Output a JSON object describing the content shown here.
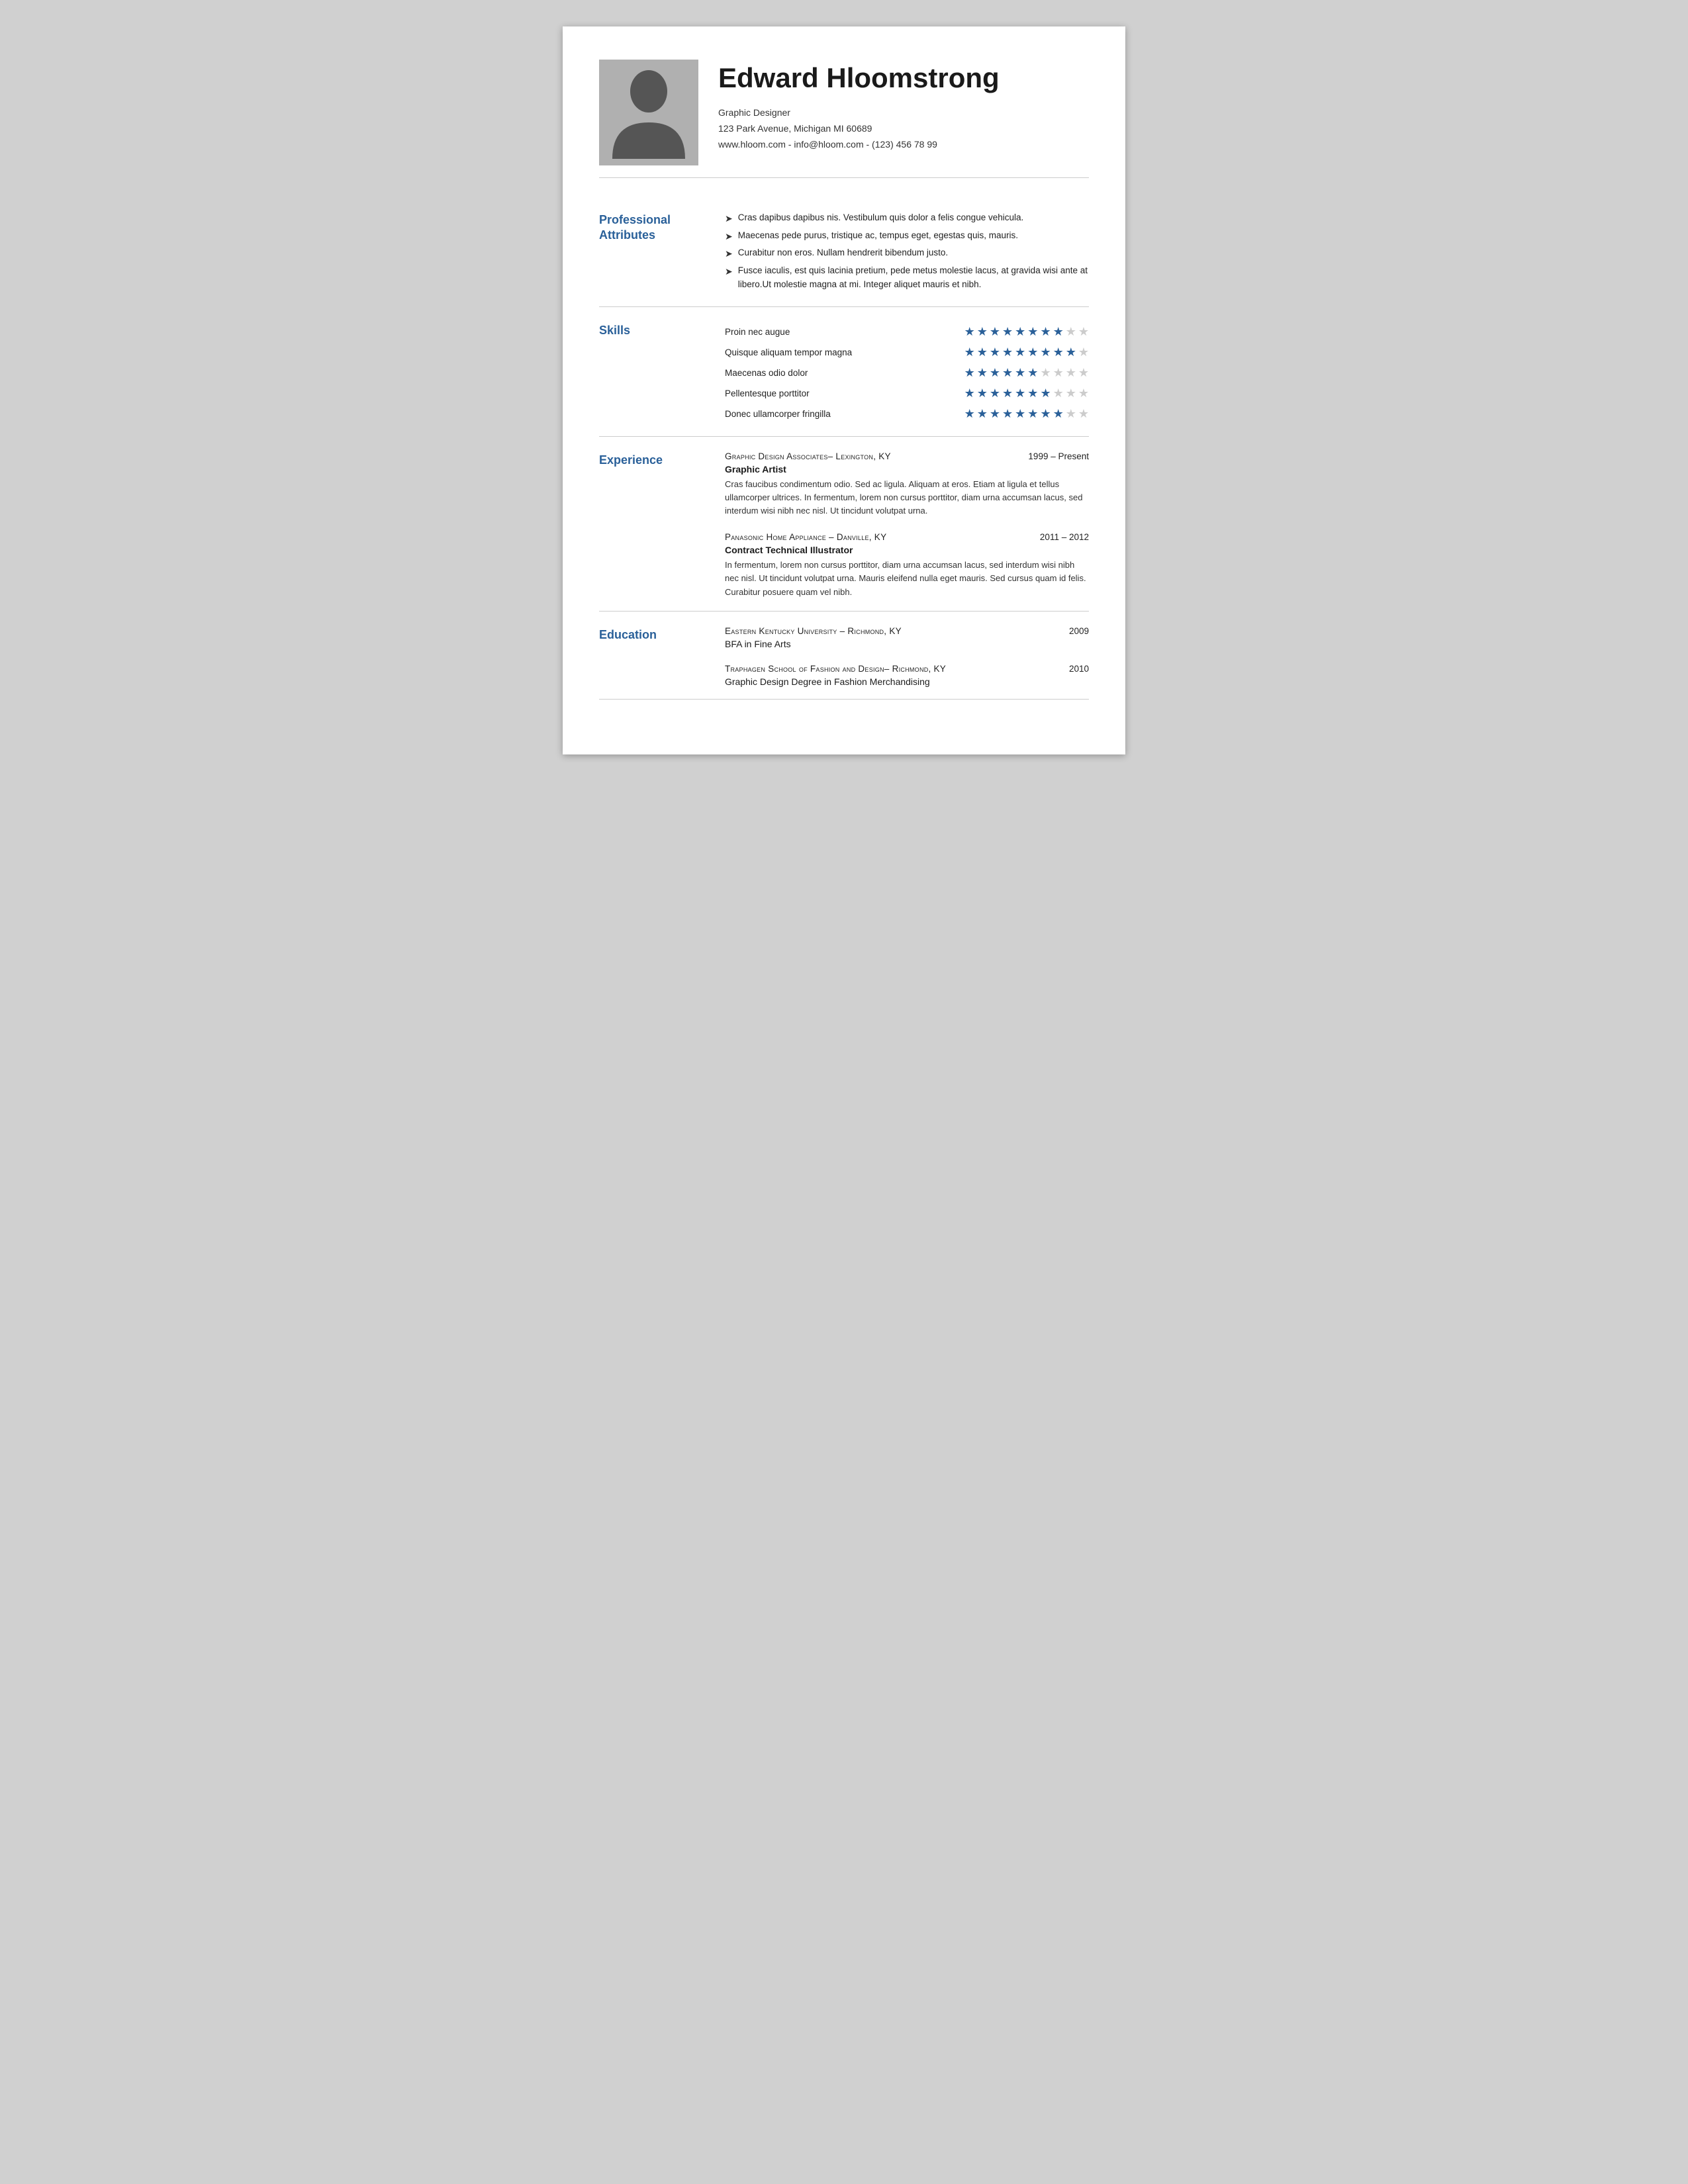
{
  "header": {
    "name": "Edward Hloomstrong",
    "title": "Graphic Designer",
    "address": "123 Park Avenue, Michigan MI 60689",
    "contact": "www.hloom.com - info@hloom.com - (123) 456 78 99"
  },
  "sections": {
    "professional": {
      "label": "Professional\nAttributes",
      "items": [
        "Cras dapibus dapibus nis. Vestibulum quis dolor a felis congue vehicula.",
        "Maecenas pede purus, tristique ac, tempus eget, egestas quis, mauris.",
        "Curabitur non eros. Nullam hendrerit bibendum justo.",
        "Fusce iaculis, est quis lacinia pretium, pede metus molestie lacus, at gravida wisi ante at libero.Ut molestie magna at mi. Integer aliquet mauris et nibh."
      ]
    },
    "skills": {
      "label": "Skills",
      "items": [
        {
          "name": "Proin nec augue",
          "filled": 8,
          "total": 10
        },
        {
          "name": "Quisque aliquam tempor magna",
          "filled": 9,
          "total": 10
        },
        {
          "name": "Maecenas odio dolor",
          "filled": 6,
          "total": 10
        },
        {
          "name": "Pellentesque porttitor",
          "filled": 7,
          "total": 10
        },
        {
          "name": "Donec ullamcorper fringilla",
          "filled": 8,
          "total": 10
        }
      ]
    },
    "experience": {
      "label": "Experience",
      "items": [
        {
          "company": "Graphic Design Associates– Lexington, KY",
          "dates": "1999 – Present",
          "title": "Graphic Artist",
          "desc": "Cras faucibus condimentum odio. Sed ac ligula. Aliquam at eros. Etiam at ligula et tellus ullamcorper ultrices. In fermentum, lorem non cursus porttitor, diam urna accumsan lacus, sed interdum wisi nibh nec nisl. Ut tincidunt volutpat urna."
        },
        {
          "company": "Panasonic Home Appliance – Danville, KY",
          "dates": "2011 – 2012",
          "title": "Contract Technical Illustrator",
          "desc": "In fermentum, lorem non cursus porttitor, diam urna accumsan lacus, sed interdum wisi nibh nec nisl. Ut tincidunt volutpat urna. Mauris eleifend nulla eget mauris. Sed cursus quam id felis. Curabitur posuere quam vel nibh."
        }
      ]
    },
    "education": {
      "label": "Education",
      "items": [
        {
          "school": "Eastern Kentucky University – Richmond, KY",
          "year": "2009",
          "degree": "BFA in Fine Arts"
        },
        {
          "school": "Traphagen School of Fashion and Design– Richmond, KY",
          "year": "2010",
          "degree": "Graphic Design Degree in Fashion Merchandising"
        }
      ]
    }
  },
  "colors": {
    "accent": "#2a6099",
    "text": "#222222",
    "muted": "#777777",
    "divider": "#cccccc"
  }
}
